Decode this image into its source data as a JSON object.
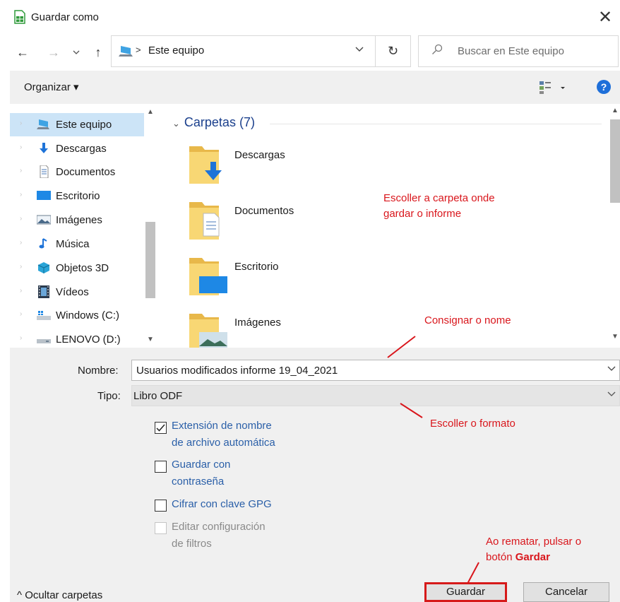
{
  "window": {
    "title": "Guardar como",
    "close_glyph": "✕",
    "app_icon": "calc-spreadsheet-icon"
  },
  "nav": {
    "back_glyph": "←",
    "forward_glyph": "→",
    "recent_glyph": "⌄",
    "up_glyph": "↑",
    "address_separator": ">",
    "address": "Este equipo",
    "address_dropdown_glyph": "⌄",
    "refresh_glyph": "↻",
    "search_placeholder": "Buscar en Este equipo"
  },
  "toolbar": {
    "organize_label": "Organizar ▾"
  },
  "sidebar": {
    "items": [
      {
        "label": "Este equipo",
        "icon": "pc-icon",
        "selected": true
      },
      {
        "label": "Descargas",
        "icon": "download-icon"
      },
      {
        "label": "Documentos",
        "icon": "document-icon"
      },
      {
        "label": "Escritorio",
        "icon": "desktop-icon"
      },
      {
        "label": "Imágenes",
        "icon": "pictures-icon"
      },
      {
        "label": "Música",
        "icon": "music-icon"
      },
      {
        "label": "Objetos 3D",
        "icon": "cube-icon"
      },
      {
        "label": "Vídeos",
        "icon": "video-icon"
      },
      {
        "label": "Windows (C:)",
        "icon": "drive-windows-icon"
      },
      {
        "label": "LENOVO (D:)",
        "icon": "drive-icon"
      }
    ]
  },
  "content": {
    "group_header": "Carpetas (7)",
    "folders": [
      {
        "label": "Descargas",
        "icon": "folder-download-icon"
      },
      {
        "label": "Documentos",
        "icon": "folder-documents-icon"
      },
      {
        "label": "Escritorio",
        "icon": "folder-desktop-icon"
      },
      {
        "label": "Imágenes",
        "icon": "folder-pictures-icon"
      }
    ]
  },
  "form": {
    "name_label": "Nombre:",
    "name_value": "Usuarios modificados informe 19_04_2021",
    "type_label": "Tipo:",
    "type_value": "Libro ODF",
    "options": [
      {
        "line1": "Extensión de nombre",
        "line2": "de archivo automática",
        "checked": true,
        "enabled": true
      },
      {
        "line1": "Guardar con",
        "line2": "contraseña",
        "checked": false,
        "enabled": true
      },
      {
        "line1": "Cifrar con clave GPG",
        "line2": "",
        "checked": false,
        "enabled": true
      },
      {
        "line1": "Editar configuración",
        "line2": "de filtros",
        "checked": false,
        "enabled": false
      }
    ]
  },
  "annotations": {
    "folder_note_1": "Escoller a carpeta onde",
    "folder_note_2": "gardar o informe",
    "name_note": "Consignar o nome",
    "format_note": "Escoller o formato",
    "save_note_1": "Ao rematar, pulsar o",
    "save_note_2_prefix": "botón ",
    "save_note_2_bold": "Gardar",
    "color": "#d9161c"
  },
  "footer": {
    "hide_folders": "^ Ocultar carpetas",
    "save_label": "Guardar",
    "cancel_label": "Cancelar"
  }
}
